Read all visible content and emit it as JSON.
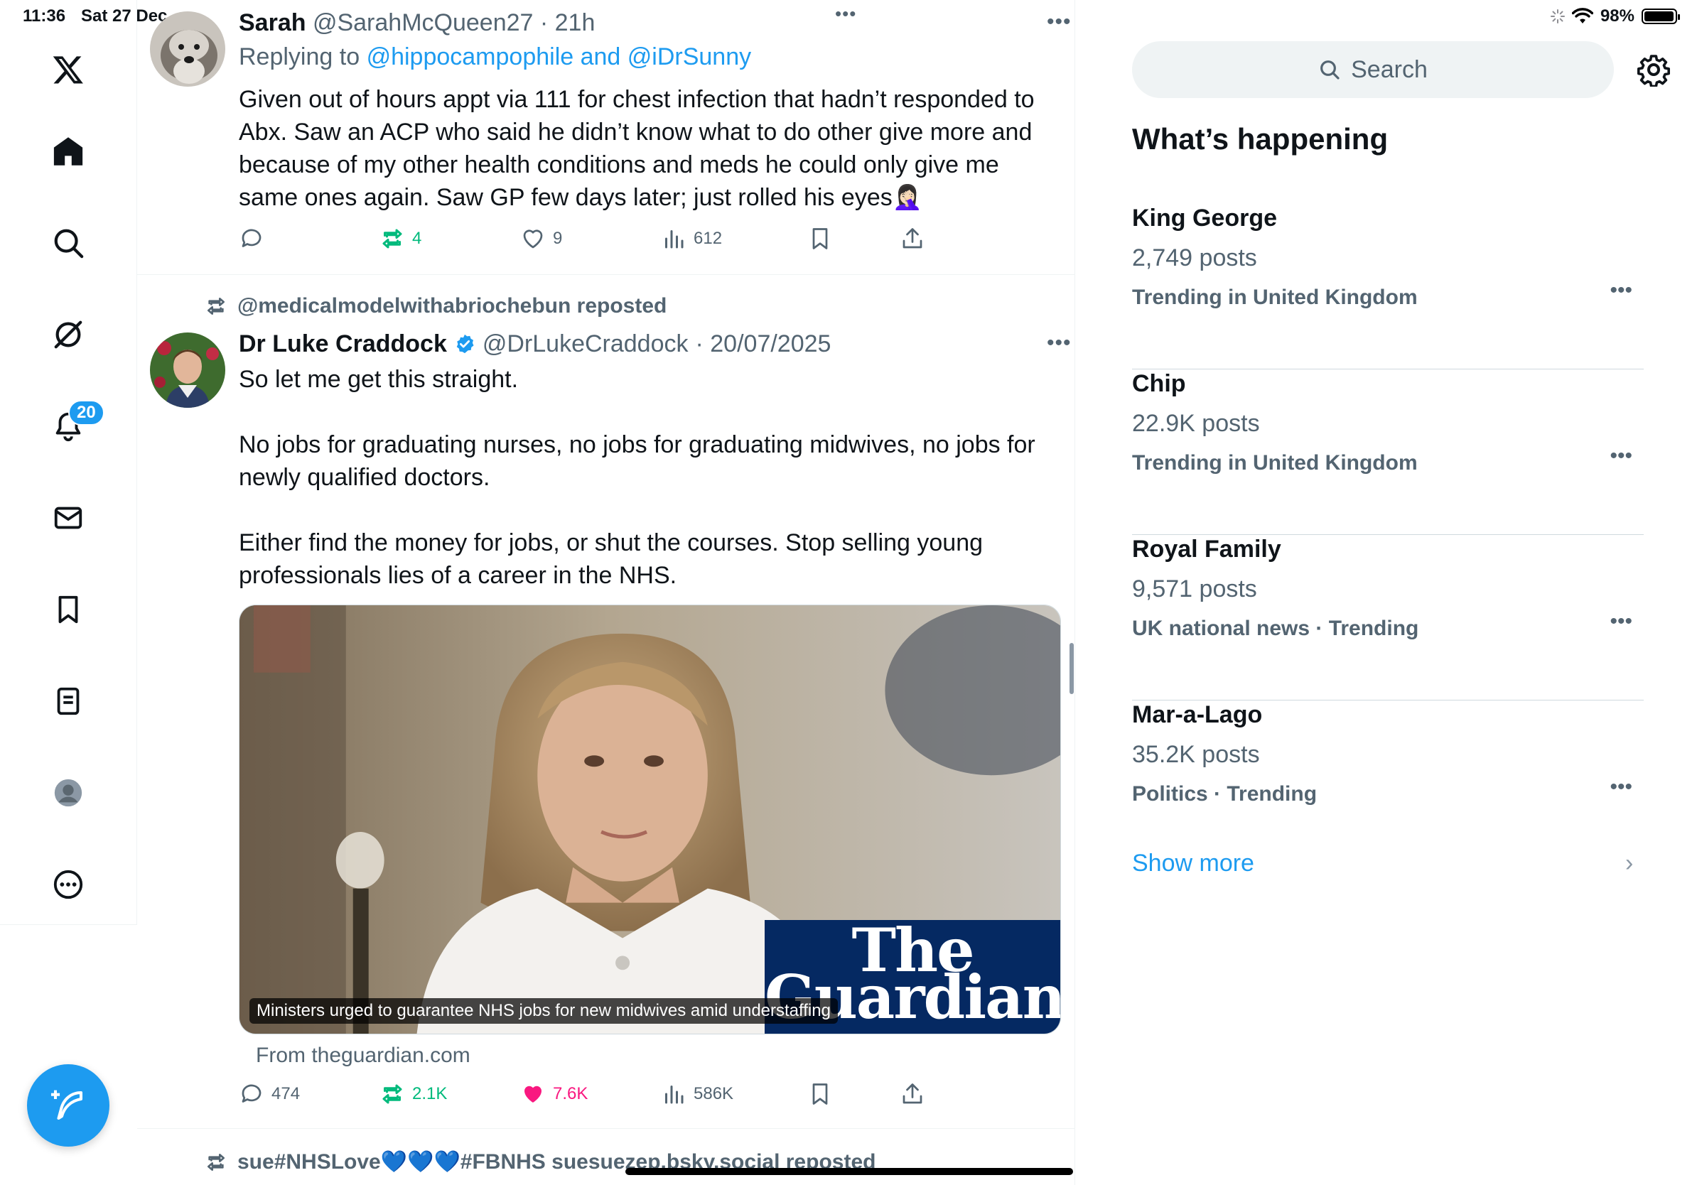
{
  "status_bar": {
    "time": "11:36",
    "date": "Sat 27 Dec",
    "battery": "98%",
    "battery_level": 0.98
  },
  "nav": {
    "items": [
      "x-logo",
      "home",
      "explore",
      "grok",
      "notifications",
      "messages",
      "bookmarks",
      "lists",
      "profile",
      "more"
    ],
    "notification_count": "20"
  },
  "feed": {
    "top_menu_dots": "•••",
    "tweet1": {
      "name": "Sarah",
      "handle": "@SarahMcQueen27",
      "time": "· 21h",
      "replying_to_prefix": "Replying to",
      "replying_to": "@hippocampophile and @iDrSunny",
      "text": "Given out of hours appt via 111 for chest infection that hadn’t responded to Abx. Saw an ACP who said he didn’t know what to do other give more and because of my other health conditions and meds he could only give me same ones again. Saw GP few days later; just rolled his eyes🤦🏻‍♀️",
      "replies": "",
      "reposts": "4",
      "likes": "9",
      "views": "612"
    },
    "tweet2": {
      "reposted_by": "@medicalmodelwithabriochebun reposted",
      "name": "Dr Luke Craddock",
      "handle": "@DrLukeCraddock",
      "time": "· 20/07/2025",
      "text": "So let me get this straight.\n\nNo jobs for graduating nurses, no jobs for graduating midwives, no jobs for newly qualified doctors.\n\nEither find the money for jobs, or shut the courses. Stop selling young professionals lies of a career in the NHS.",
      "card_brand_line1": "The",
      "card_brand_line2": "Guardian",
      "card_caption": "Ministers urged to guarantee NHS jobs for new midwives amid understaffing",
      "card_domain": "From theguardian.com",
      "replies": "474",
      "reposts": "2.1K",
      "likes": "7.6K",
      "views": "586K"
    },
    "tweet3": {
      "reposted_by": "sue#NHSLove💙💙💙#FBNHS suesuezep.bsky.social reposted"
    }
  },
  "sidebar": {
    "search_placeholder": "Search",
    "title": "What’s happening",
    "trends": [
      {
        "name": "King George",
        "posts": "2,749 posts",
        "context": "Trending in United Kingdom"
      },
      {
        "name": "Chip",
        "posts": "22.9K posts",
        "context": "Trending in United Kingdom"
      },
      {
        "name": "Royal Family",
        "posts": "9,571 posts",
        "context": "UK national news · Trending"
      },
      {
        "name": "Mar-a-Lago",
        "posts": "35.2K posts",
        "context": "Politics · Trending"
      }
    ],
    "show_more": "Show more",
    "trend_menu_dots": "•••",
    "chevron": "›"
  },
  "colors": {
    "accent": "#1d9bf0",
    "repost_green": "#00ba7c",
    "like_pink": "#f91880",
    "muted": "#536471",
    "guardian_blue": "#052962"
  }
}
